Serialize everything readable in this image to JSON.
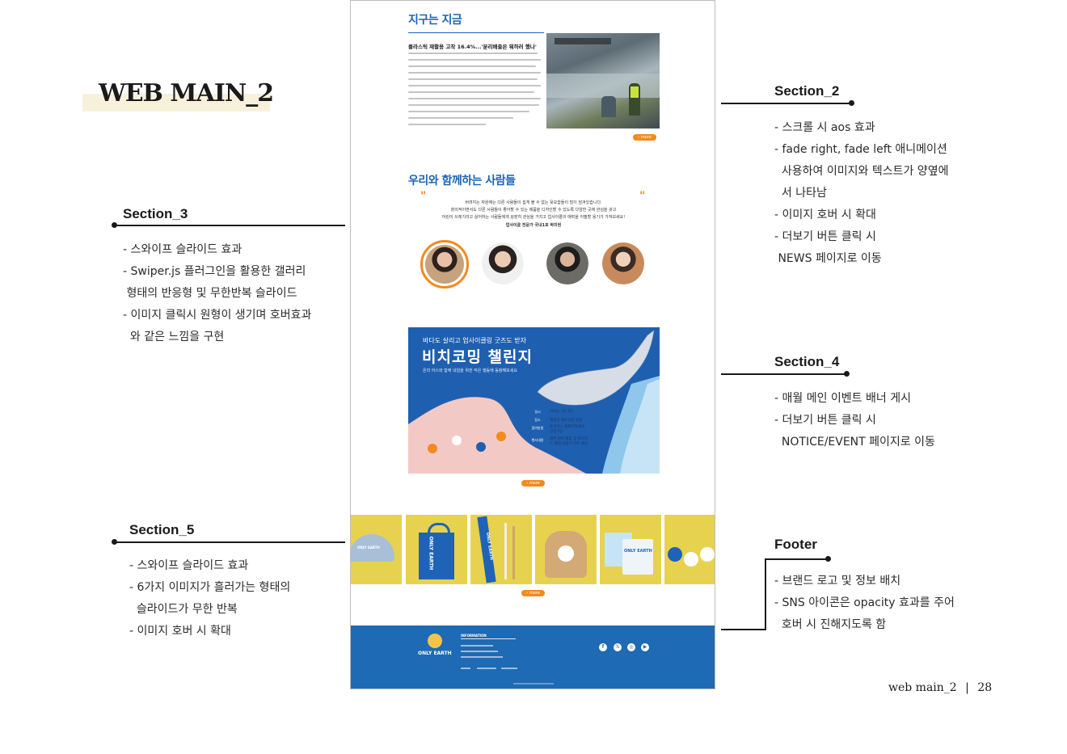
{
  "page": {
    "title": "WEB MAIN_2",
    "footer_name": "web main_2",
    "footer_page": "28"
  },
  "annotations": {
    "section2": {
      "label": "Section_2",
      "lines": [
        "- 스크롤 시 aos 효과",
        "- fade right, fade left  애니메이션",
        "  사용하여 이미지와 텍스트가 양옆에",
        "  서 나타남",
        "- 이미지 호버 시 확대",
        "- 더보기 버튼 클릭 시",
        " NEWS 페이지로 이동"
      ]
    },
    "section3": {
      "label": "Section_3",
      "lines": [
        "- 스와이프 슬라이드 효과",
        "- Swiper.js 플러그인을 활용한 갤러리",
        " 형태의 반응형 및 무한반복 슬라이드",
        "- 이미지 클릭시 원형이 생기며 호버효과",
        "  와 같은 느낌을 구현"
      ]
    },
    "section4": {
      "label": "Section_4",
      "lines": [
        "- 매월 메인 이벤트 배너 게시",
        "- 더보기 버튼 클릭 시",
        "  NOTICE/EVENT 페이지로 이동"
      ]
    },
    "section5": {
      "label": "Section_5",
      "lines": [
        "- 스와이프 슬라이드 효과",
        "- 6가지 이미지가 흘러가는 형태의",
        "  슬라이드가 무한 반복",
        "- 이미지 호버 시 확대"
      ]
    },
    "footer": {
      "label": "Footer",
      "lines": [
        "- 브랜드 로고 및 정보 배치",
        "- SNS 아이콘은 opacity 효과를 주어",
        "  호버 시 진해지도록 함"
      ]
    }
  },
  "site": {
    "news": {
      "title": "지구는 지금",
      "headline": "플라스틱 재활용 고작 16.4%...'분리배출은 뭐하러 했나'",
      "more": "more"
    },
    "people": {
      "title": "우리와 함께하는 사람들",
      "quote_lines": [
        "버려지는 자원에는 다른 사람들이 쉽게 볼 수 없는 뒷모습들이 많이 담겨있습니다.",
        "창의적이면서도 다른 사람들이 좋아할 수 있는 제품을 디자인할 수 있도록 다양한 곳에 관심을 갖고",
        "어린이 쓰레기라고 싫어하는 사람들에게 굉장히 관심을 가지고 업사이클의 매력을 어필할 용기가 가져보세요!"
      ],
      "person": "업사이클 전문가 국내1호 박미현"
    },
    "event": {
      "subtitle": "바다도 살리고 업사이클링 굿즈도 받자",
      "title": "비치코밍 챌린지",
      "description": "온리 어스와 함께 내일을 위한 작은 행동에 동참해보세요",
      "info": [
        {
          "key": "일시",
          "value": "2024. 10. 01"
        },
        {
          "key": "장소",
          "value": "해운대 해수욕장 일대"
        },
        {
          "key": "참여방법",
          "value": "온리어스 홈페이지에서 신청가능"
        },
        {
          "key": "행사내용",
          "value": "해변 정화 활동 및 파라코드 팔찌 만들기 키트 제공"
        }
      ],
      "more": "more"
    },
    "goods": {
      "items": [
        "cap",
        "tote-bag",
        "straw-set",
        "drawstring-bag",
        "mug",
        "keyring"
      ],
      "cap_logo": "ONLY EARTH",
      "bag_text": "ONLY EARTH",
      "straw_text": "ONLY EARTH",
      "mug_text": "ONLY EARTH",
      "more": "more"
    },
    "footer": {
      "logo": "ONLY EARTH",
      "info_title": "INFORMATION",
      "sns": [
        "facebook-icon",
        "x-icon",
        "instagram-icon",
        "youtube-icon"
      ]
    }
  },
  "colors": {
    "brand_blue": "#1e63b6",
    "accent_orange": "#f28a1e",
    "goods_yellow": "#e7d24f"
  }
}
